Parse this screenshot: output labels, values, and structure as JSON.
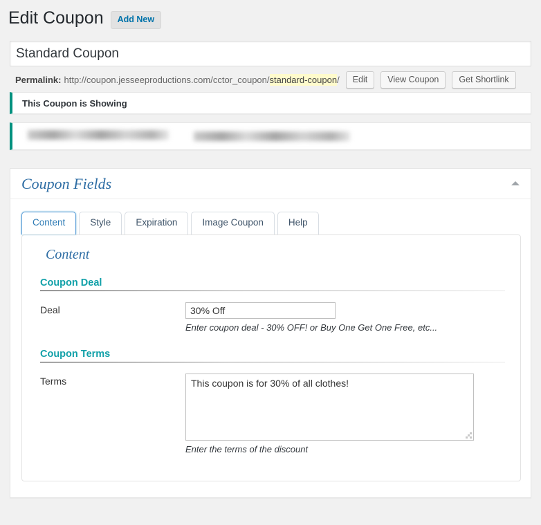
{
  "header": {
    "title": "Edit Coupon",
    "add_new_label": "Add New"
  },
  "post_title": {
    "value": "Standard Coupon"
  },
  "permalink": {
    "label": "Permalink:",
    "base_url": "http://coupon.jesseeproductions.com/cctor_coupon/",
    "slug": "standard-coupon",
    "trailing_slash": "/",
    "edit_label": "Edit",
    "view_label": "View Coupon",
    "shortlink_label": "Get Shortlink"
  },
  "notices": [
    {
      "text": "This Coupon is Showing",
      "redacted": false
    },
    {
      "text": "",
      "redacted": true
    }
  ],
  "metabox": {
    "title": "Coupon Fields",
    "toggle_icon": "triangle-up-icon",
    "tabs": [
      {
        "label": "Content",
        "active": true
      },
      {
        "label": "Style",
        "active": false
      },
      {
        "label": "Expiration",
        "active": false
      },
      {
        "label": "Image Coupon",
        "active": false
      },
      {
        "label": "Help",
        "active": false
      }
    ],
    "panel": {
      "heading": "Content",
      "sections": [
        {
          "title": "Coupon Deal",
          "field_label": "Deal",
          "field_value": "30% Off",
          "field_help": "Enter coupon deal - 30% OFF! or Buy One Get One Free, etc..."
        },
        {
          "title": "Coupon Terms",
          "field_label": "Terms",
          "field_value": "This coupon is for 30% of all clothes!",
          "field_help": "Enter the terms of the discount"
        }
      ]
    }
  },
  "colors": {
    "accent_teal": "#00917f",
    "link_blue": "#0073aa",
    "heading_blue": "#2e6da4",
    "section_teal": "#10a0a8",
    "highlight_yellow": "#fffbcc"
  }
}
